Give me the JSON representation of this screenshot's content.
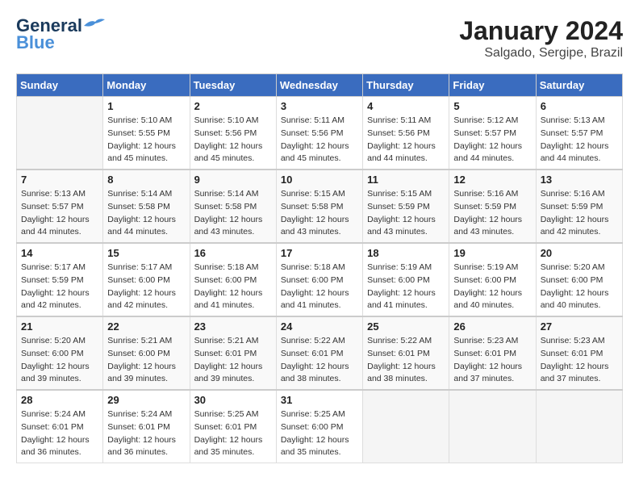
{
  "logo": {
    "line1": "General",
    "line2": "Blue"
  },
  "title": "January 2024",
  "subtitle": "Salgado, Sergipe, Brazil",
  "days_header": [
    "Sunday",
    "Monday",
    "Tuesday",
    "Wednesday",
    "Thursday",
    "Friday",
    "Saturday"
  ],
  "weeks": [
    [
      {
        "day": "",
        "info": ""
      },
      {
        "day": "1",
        "info": "Sunrise: 5:10 AM\nSunset: 5:55 PM\nDaylight: 12 hours\nand 45 minutes."
      },
      {
        "day": "2",
        "info": "Sunrise: 5:10 AM\nSunset: 5:56 PM\nDaylight: 12 hours\nand 45 minutes."
      },
      {
        "day": "3",
        "info": "Sunrise: 5:11 AM\nSunset: 5:56 PM\nDaylight: 12 hours\nand 45 minutes."
      },
      {
        "day": "4",
        "info": "Sunrise: 5:11 AM\nSunset: 5:56 PM\nDaylight: 12 hours\nand 44 minutes."
      },
      {
        "day": "5",
        "info": "Sunrise: 5:12 AM\nSunset: 5:57 PM\nDaylight: 12 hours\nand 44 minutes."
      },
      {
        "day": "6",
        "info": "Sunrise: 5:13 AM\nSunset: 5:57 PM\nDaylight: 12 hours\nand 44 minutes."
      }
    ],
    [
      {
        "day": "7",
        "info": "Sunrise: 5:13 AM\nSunset: 5:57 PM\nDaylight: 12 hours\nand 44 minutes."
      },
      {
        "day": "8",
        "info": "Sunrise: 5:14 AM\nSunset: 5:58 PM\nDaylight: 12 hours\nand 44 minutes."
      },
      {
        "day": "9",
        "info": "Sunrise: 5:14 AM\nSunset: 5:58 PM\nDaylight: 12 hours\nand 43 minutes."
      },
      {
        "day": "10",
        "info": "Sunrise: 5:15 AM\nSunset: 5:58 PM\nDaylight: 12 hours\nand 43 minutes."
      },
      {
        "day": "11",
        "info": "Sunrise: 5:15 AM\nSunset: 5:59 PM\nDaylight: 12 hours\nand 43 minutes."
      },
      {
        "day": "12",
        "info": "Sunrise: 5:16 AM\nSunset: 5:59 PM\nDaylight: 12 hours\nand 43 minutes."
      },
      {
        "day": "13",
        "info": "Sunrise: 5:16 AM\nSunset: 5:59 PM\nDaylight: 12 hours\nand 42 minutes."
      }
    ],
    [
      {
        "day": "14",
        "info": "Sunrise: 5:17 AM\nSunset: 5:59 PM\nDaylight: 12 hours\nand 42 minutes."
      },
      {
        "day": "15",
        "info": "Sunrise: 5:17 AM\nSunset: 6:00 PM\nDaylight: 12 hours\nand 42 minutes."
      },
      {
        "day": "16",
        "info": "Sunrise: 5:18 AM\nSunset: 6:00 PM\nDaylight: 12 hours\nand 41 minutes."
      },
      {
        "day": "17",
        "info": "Sunrise: 5:18 AM\nSunset: 6:00 PM\nDaylight: 12 hours\nand 41 minutes."
      },
      {
        "day": "18",
        "info": "Sunrise: 5:19 AM\nSunset: 6:00 PM\nDaylight: 12 hours\nand 41 minutes."
      },
      {
        "day": "19",
        "info": "Sunrise: 5:19 AM\nSunset: 6:00 PM\nDaylight: 12 hours\nand 40 minutes."
      },
      {
        "day": "20",
        "info": "Sunrise: 5:20 AM\nSunset: 6:00 PM\nDaylight: 12 hours\nand 40 minutes."
      }
    ],
    [
      {
        "day": "21",
        "info": "Sunrise: 5:20 AM\nSunset: 6:00 PM\nDaylight: 12 hours\nand 39 minutes."
      },
      {
        "day": "22",
        "info": "Sunrise: 5:21 AM\nSunset: 6:00 PM\nDaylight: 12 hours\nand 39 minutes."
      },
      {
        "day": "23",
        "info": "Sunrise: 5:21 AM\nSunset: 6:01 PM\nDaylight: 12 hours\nand 39 minutes."
      },
      {
        "day": "24",
        "info": "Sunrise: 5:22 AM\nSunset: 6:01 PM\nDaylight: 12 hours\nand 38 minutes."
      },
      {
        "day": "25",
        "info": "Sunrise: 5:22 AM\nSunset: 6:01 PM\nDaylight: 12 hours\nand 38 minutes."
      },
      {
        "day": "26",
        "info": "Sunrise: 5:23 AM\nSunset: 6:01 PM\nDaylight: 12 hours\nand 37 minutes."
      },
      {
        "day": "27",
        "info": "Sunrise: 5:23 AM\nSunset: 6:01 PM\nDaylight: 12 hours\nand 37 minutes."
      }
    ],
    [
      {
        "day": "28",
        "info": "Sunrise: 5:24 AM\nSunset: 6:01 PM\nDaylight: 12 hours\nand 36 minutes."
      },
      {
        "day": "29",
        "info": "Sunrise: 5:24 AM\nSunset: 6:01 PM\nDaylight: 12 hours\nand 36 minutes."
      },
      {
        "day": "30",
        "info": "Sunrise: 5:25 AM\nSunset: 6:01 PM\nDaylight: 12 hours\nand 35 minutes."
      },
      {
        "day": "31",
        "info": "Sunrise: 5:25 AM\nSunset: 6:00 PM\nDaylight: 12 hours\nand 35 minutes."
      },
      {
        "day": "",
        "info": ""
      },
      {
        "day": "",
        "info": ""
      },
      {
        "day": "",
        "info": ""
      }
    ]
  ]
}
